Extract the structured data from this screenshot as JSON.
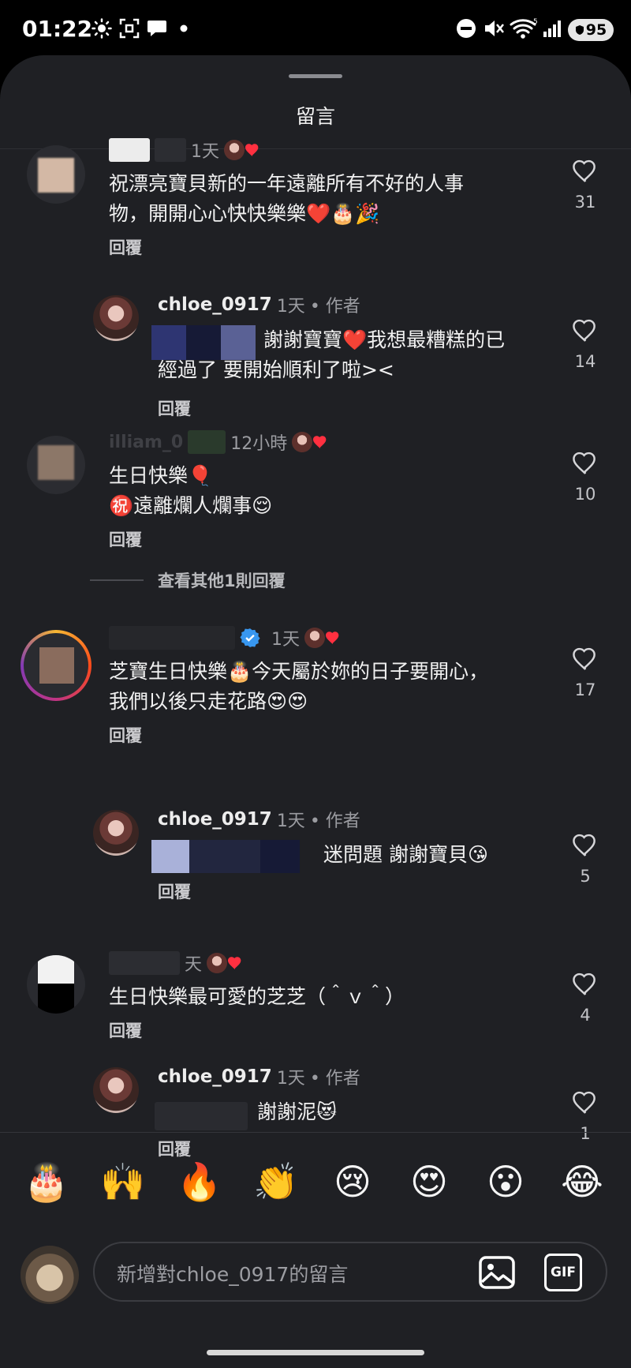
{
  "status_bar": {
    "time": "01:22",
    "battery": "95"
  },
  "sheet": {
    "title": "留言"
  },
  "comments": [
    {
      "time": "1天",
      "text_lines": [
        "祝漂亮寶貝新的一年遠離所有不好的人事",
        "物，開開心心快快樂樂❤️🎂🎉"
      ],
      "reply": "回覆",
      "likes": "31"
    },
    {
      "username": "chloe_0917",
      "time": "1天",
      "author_tag": "• 作者",
      "text_lines": [
        "謝謝寶寶❤️我想最糟糕的已",
        "經過了 要開始順利了啦><"
      ],
      "reply": "回覆",
      "likes": "14"
    },
    {
      "time": "12小時",
      "username_partial": "illiam_0",
      "text_lines": [
        "生日快樂🎈",
        "㊗️遠離爛人爛事😌"
      ],
      "reply": "回覆",
      "likes": "10"
    },
    {
      "time": "1天",
      "text_lines": [
        "芝寶生日快樂🎂今天屬於妳的日子要開心，",
        "我們以後只走花路😍😍"
      ],
      "reply": "回覆",
      "likes": "17"
    },
    {
      "username": "chloe_0917",
      "time": "1天",
      "author_tag": "• 作者",
      "text_lines": [
        "迷問題 謝謝寶貝😘"
      ],
      "reply": "回覆",
      "likes": "5"
    },
    {
      "time": "天",
      "text_lines": [
        "生日快樂最可愛的芝芝（＾ｖ＾）"
      ],
      "reply": "回覆",
      "likes": "4"
    },
    {
      "username": "chloe_0917",
      "time": "1天",
      "author_tag": "• 作者",
      "text_lines": [
        "謝謝泥😻"
      ],
      "reply": "回覆",
      "likes": "1"
    }
  ],
  "more_replies": "查看其他1則回覆",
  "emoji_bar": [
    "🎂",
    "🙌",
    "🔥",
    "👏",
    "😢",
    "😍",
    "😮",
    "😂"
  ],
  "input": {
    "placeholder": "新增對chloe_0917的留言",
    "gif_label": "GIF"
  },
  "colors": {
    "sheet_bg": "#1f2024",
    "accent_heart": "#ff3040"
  }
}
